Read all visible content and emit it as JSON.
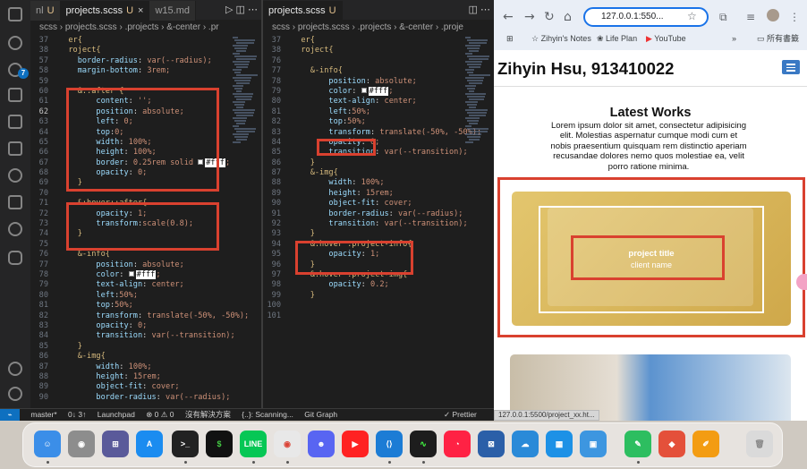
{
  "editor": {
    "pane_left": {
      "tabs": [
        {
          "label": "nl",
          "modified": "U",
          "active": false
        },
        {
          "label": "projects.scss",
          "modified": "U",
          "active": true
        },
        {
          "label": "w15.md",
          "modified": "M",
          "active": false
        }
      ],
      "breadcrumb": "scss › projects.scss › .projects › &-center › .pr",
      "lines": [
        {
          "n": 37,
          "text": "  er{"
        },
        {
          "n": 38,
          "text": "  roject{"
        },
        {
          "n": 57,
          "text": "    border-radius: var(--radius);"
        },
        {
          "n": 58,
          "text": "    margin-bottom: 3rem;"
        },
        {
          "n": 59,
          "text": ""
        },
        {
          "n": 60,
          "text": "    &::after {"
        },
        {
          "n": 61,
          "text": "        content: '';"
        },
        {
          "n": 62,
          "text": "        position: absolute;"
        },
        {
          "n": 63,
          "text": "        left: 0;"
        },
        {
          "n": 64,
          "text": "        top:0;"
        },
        {
          "n": 65,
          "text": "        width: 100%;"
        },
        {
          "n": 66,
          "text": "        height: 100%;"
        },
        {
          "n": 67,
          "text": "        border: 0.25rem solid #fff;"
        },
        {
          "n": 68,
          "text": "        opacity: 0;"
        },
        {
          "n": 69,
          "text": "    }"
        },
        {
          "n": 70,
          "text": ""
        },
        {
          "n": 71,
          "text": "    &:hover::after{"
        },
        {
          "n": 72,
          "text": "        opacity: 1;"
        },
        {
          "n": 73,
          "text": "        transform:scale(0.8);"
        },
        {
          "n": 74,
          "text": "    }"
        },
        {
          "n": 75,
          "text": ""
        },
        {
          "n": 76,
          "text": "    &-info{"
        },
        {
          "n": 77,
          "text": "        position: absolute;"
        },
        {
          "n": 78,
          "text": "        color: #fff;"
        },
        {
          "n": 79,
          "text": "        text-align: center;"
        },
        {
          "n": 80,
          "text": "        left:50%;"
        },
        {
          "n": 81,
          "text": "        top:50%;"
        },
        {
          "n": 82,
          "text": "        transform: translate(-50%, -50%);"
        },
        {
          "n": 83,
          "text": "        opacity: 0;"
        },
        {
          "n": 84,
          "text": "        transition: var(--transition);"
        },
        {
          "n": 85,
          "text": "    }"
        },
        {
          "n": 86,
          "text": "    &-img{"
        },
        {
          "n": 87,
          "text": "        width: 100%;"
        },
        {
          "n": 88,
          "text": "        height: 15rem;"
        },
        {
          "n": 89,
          "text": "        object-fit: cover;"
        },
        {
          "n": 90,
          "text": "        border-radius: var(--radius);"
        }
      ]
    },
    "pane_right": {
      "tabs": [
        {
          "label": "projects.scss",
          "modified": "U",
          "active": true
        }
      ],
      "breadcrumb": "scss › projects.scss › .projects › &-center › .proje",
      "lines": [
        {
          "n": 37,
          "text": "  er{"
        },
        {
          "n": 38,
          "text": "  roject{"
        },
        {
          "n": 76,
          "text": ""
        },
        {
          "n": 77,
          "text": "    &-info{"
        },
        {
          "n": 78,
          "text": "        position: absolute;"
        },
        {
          "n": 79,
          "text": "        color: #fff;"
        },
        {
          "n": 80,
          "text": "        text-align: center;"
        },
        {
          "n": 81,
          "text": "        left:50%;"
        },
        {
          "n": 82,
          "text": "        top:50%;"
        },
        {
          "n": 83,
          "text": "        transform: translate(-50%, -50%);"
        },
        {
          "n": 84,
          "text": "        opacity: 0;"
        },
        {
          "n": 85,
          "text": "        transition: var(--transition);"
        },
        {
          "n": 86,
          "text": "    }"
        },
        {
          "n": 87,
          "text": "    &-img{"
        },
        {
          "n": 88,
          "text": "        width: 100%;"
        },
        {
          "n": 89,
          "text": "        height: 15rem;"
        },
        {
          "n": 90,
          "text": "        object-fit: cover;"
        },
        {
          "n": 91,
          "text": "        border-radius: var(--radius);"
        },
        {
          "n": 92,
          "text": "        transition: var(--transition);"
        },
        {
          "n": 93,
          "text": "    }"
        },
        {
          "n": 94,
          "text": "    &:hover .project-info{"
        },
        {
          "n": 95,
          "text": "        opacity: 1;"
        },
        {
          "n": 96,
          "text": "    }"
        },
        {
          "n": 97,
          "text": "    &:hover .project-img{"
        },
        {
          "n": 98,
          "text": "        opacity: 0.2;"
        },
        {
          "n": 99,
          "text": "    }"
        },
        {
          "n": 100,
          "text": ""
        },
        {
          "n": 101,
          "text": ""
        }
      ]
    },
    "statusbar": {
      "branch": "master*",
      "sync": "0↓ 3↑",
      "launchpad": "Launchpad",
      "problems": "⊗ 0  ⚠ 0",
      "unresolved": "沒有解決方案",
      "scanning": "{..}: Scanning...",
      "git_graph": "Git Graph",
      "prettier": "✓ Prettier"
    },
    "badge_count": "7"
  },
  "browser": {
    "url": "127.0.0.1:550...",
    "bookmarks": [
      "Zihyin's Notes",
      "Life Plan",
      "YouTube"
    ],
    "other_bookmarks": "所有書籤",
    "site_title": "Zihyin Hsu, 913410022",
    "section_title": "Latest Works",
    "lorem": "Lorem ipsum dolor sit amet, consectetur adipisicing elit. Molestias aspernatur cumque modi cum et nobis praesentium quisquam rem distinctio aperiam recusandae dolores nemo quos molestiae ea, velit porro ratione minima.",
    "project_title": "project title",
    "client_name": "client name",
    "status_url": "127.0.0.1:5500/project_xx.ht..."
  },
  "colors": {
    "highlight": "#d9412f",
    "accent": "#3a79c4"
  }
}
